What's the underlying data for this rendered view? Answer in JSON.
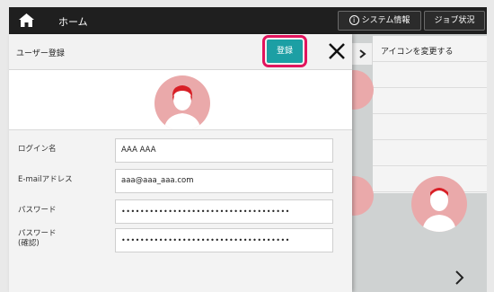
{
  "topbar": {
    "home_label": "ホーム",
    "system_info_label": "システム情報",
    "job_status_label": "ジョブ状況"
  },
  "background": {
    "right_panel_title": "アイコンを変更する"
  },
  "dialog": {
    "title": "ユーザー登録",
    "register_label": "登録",
    "fields": [
      {
        "label": "ログイン名",
        "value": "AAA AAA"
      },
      {
        "label": "E-mailアドレス",
        "value": "aaa@aaa_aaa.com"
      },
      {
        "label": "パスワード",
        "value": "••••••••••••••••••••••••••••••••••••"
      },
      {
        "label": "パスワード\n(確認)",
        "value": "••••••••••••••••••••••••••••••••••••"
      }
    ]
  },
  "colors": {
    "accent": "#1c9fa4",
    "highlight": "#e2145d",
    "avatar_bg": "#eaa9aa",
    "topbar": "#1f1f1f"
  },
  "icons": [
    "home-icon",
    "info-icon",
    "close-icon",
    "chevron-right-icon",
    "user-avatar-icon"
  ]
}
